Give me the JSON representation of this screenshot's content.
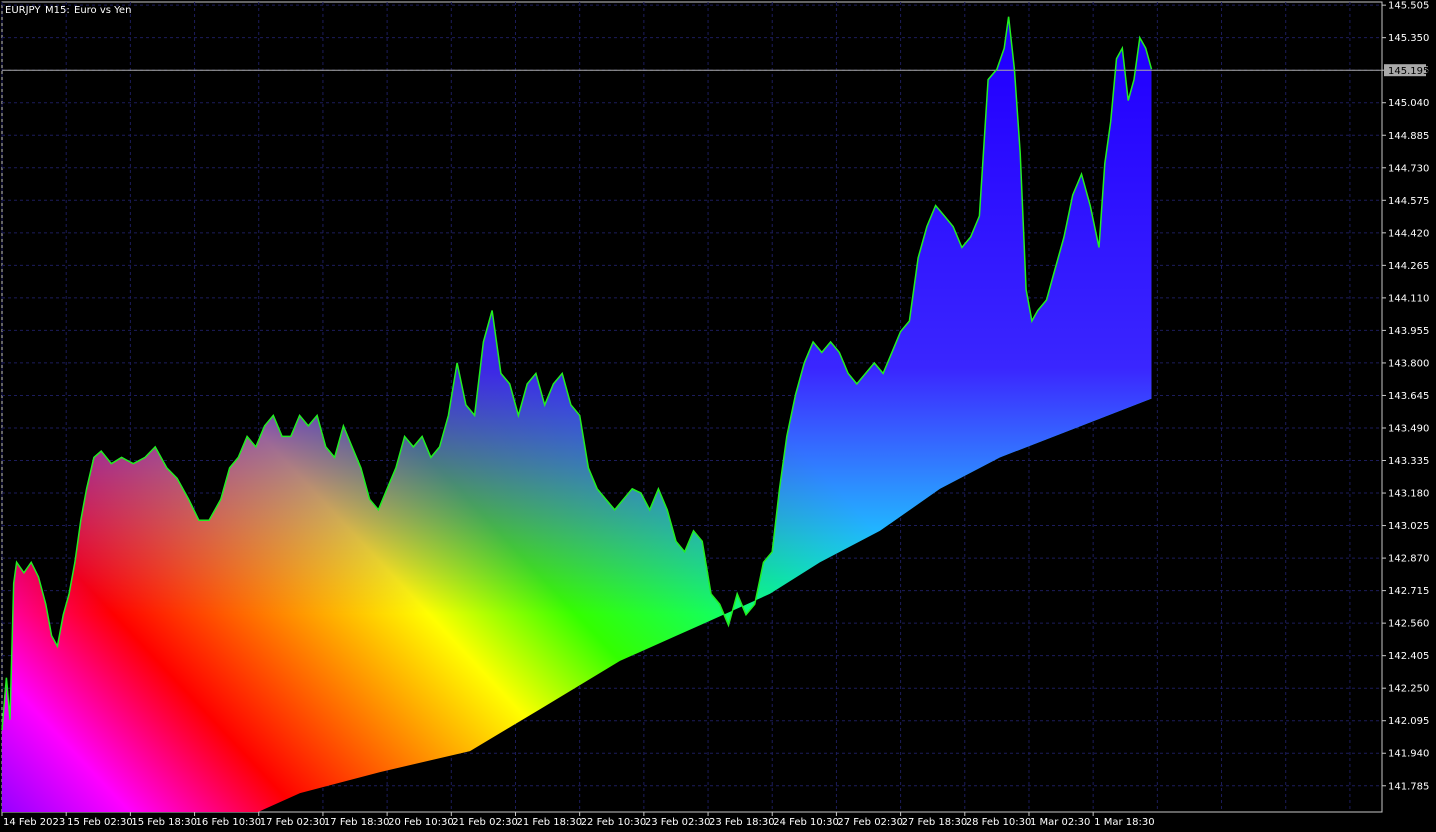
{
  "header": {
    "symbol": "EURJPY",
    "timeframe": "M15:",
    "description": "Euro vs Yen"
  },
  "colors": {
    "background": "#000000",
    "grid": "#1c1c5c",
    "axis": "#c8c8c8",
    "text": "#ffffff",
    "price_line": "#aaaaaa",
    "price_series": "#22ee22",
    "price_tag_bg": "#a9a9a9"
  },
  "chart_data": {
    "type": "area",
    "y_axis": {
      "side": "right",
      "ticks": [
        "145.505",
        "145.350",
        "145.195",
        "145.040",
        "144.885",
        "144.730",
        "144.575",
        "144.420",
        "144.265",
        "144.110",
        "143.955",
        "143.800",
        "143.645",
        "143.490",
        "143.335",
        "143.180",
        "143.025",
        "142.870",
        "142.715",
        "142.560",
        "142.405",
        "142.250",
        "142.095",
        "141.940",
        "141.785"
      ],
      "ylim": [
        141.66,
        145.52
      ]
    },
    "x_axis": {
      "ticks": [
        "14 Feb 2023",
        "15 Feb 02:30",
        "15 Feb 18:30",
        "16 Feb 10:30",
        "17 Feb 02:30",
        "17 Feb 18:30",
        "20 Feb 10:30",
        "21 Feb 02:30",
        "21 Feb 18:30",
        "22 Feb 10:30",
        "23 Feb 02:30",
        "23 Feb 18:30",
        "24 Feb 10:30",
        "27 Feb 02:30",
        "27 Feb 18:30",
        "28 Feb 10:30",
        "1 Mar 02:30",
        "1 Mar 18:30"
      ]
    },
    "current_price": "145.195",
    "grid": true,
    "series": [
      {
        "role": "price",
        "color": "#22ee22",
        "points": [
          [
            0.0,
            142.05
          ],
          [
            0.3,
            142.3
          ],
          [
            0.55,
            142.1
          ],
          [
            0.8,
            142.75
          ],
          [
            1.0,
            142.85
          ],
          [
            1.5,
            142.8
          ],
          [
            2.0,
            142.85
          ],
          [
            2.5,
            142.78
          ],
          [
            3.0,
            142.65
          ],
          [
            3.4,
            142.5
          ],
          [
            3.8,
            142.45
          ],
          [
            4.2,
            142.6
          ],
          [
            4.6,
            142.7
          ],
          [
            5.0,
            142.85
          ],
          [
            5.4,
            143.05
          ],
          [
            5.8,
            143.2
          ],
          [
            6.3,
            143.35
          ],
          [
            6.8,
            143.38
          ],
          [
            7.5,
            143.32
          ],
          [
            8.2,
            143.35
          ],
          [
            9.0,
            143.32
          ],
          [
            9.8,
            143.35
          ],
          [
            10.5,
            143.4
          ],
          [
            11.3,
            143.3
          ],
          [
            12.0,
            143.25
          ],
          [
            12.8,
            143.15
          ],
          [
            13.5,
            143.05
          ],
          [
            14.2,
            143.05
          ],
          [
            15.0,
            143.15
          ],
          [
            15.6,
            143.3
          ],
          [
            16.2,
            143.35
          ],
          [
            16.8,
            143.45
          ],
          [
            17.4,
            143.4
          ],
          [
            18.0,
            143.5
          ],
          [
            18.6,
            143.55
          ],
          [
            19.2,
            143.45
          ],
          [
            19.8,
            143.45
          ],
          [
            20.4,
            143.55
          ],
          [
            21.0,
            143.5
          ],
          [
            21.6,
            143.55
          ],
          [
            22.2,
            143.4
          ],
          [
            22.8,
            143.35
          ],
          [
            23.4,
            143.5
          ],
          [
            24.0,
            143.4
          ],
          [
            24.6,
            143.3
          ],
          [
            25.2,
            143.15
          ],
          [
            25.8,
            143.1
          ],
          [
            26.4,
            143.2
          ],
          [
            27.0,
            143.3
          ],
          [
            27.6,
            143.45
          ],
          [
            28.2,
            143.4
          ],
          [
            28.8,
            143.45
          ],
          [
            29.4,
            143.35
          ],
          [
            30.0,
            143.4
          ],
          [
            30.6,
            143.55
          ],
          [
            31.2,
            143.8
          ],
          [
            31.8,
            143.6
          ],
          [
            32.4,
            143.55
          ],
          [
            33.0,
            143.9
          ],
          [
            33.6,
            144.05
          ],
          [
            34.2,
            143.75
          ],
          [
            34.8,
            143.7
          ],
          [
            35.4,
            143.55
          ],
          [
            36.0,
            143.7
          ],
          [
            36.6,
            143.75
          ],
          [
            37.2,
            143.6
          ],
          [
            37.8,
            143.7
          ],
          [
            38.4,
            143.75
          ],
          [
            39.0,
            143.6
          ],
          [
            39.6,
            143.55
          ],
          [
            40.2,
            143.3
          ],
          [
            40.8,
            143.2
          ],
          [
            41.4,
            143.15
          ],
          [
            42.0,
            143.1
          ],
          [
            42.6,
            143.15
          ],
          [
            43.2,
            143.2
          ],
          [
            43.8,
            143.18
          ],
          [
            44.4,
            143.1
          ],
          [
            45.0,
            143.2
          ],
          [
            45.6,
            143.1
          ],
          [
            46.2,
            142.95
          ],
          [
            46.8,
            142.9
          ],
          [
            47.4,
            143.0
          ],
          [
            48.0,
            142.95
          ],
          [
            48.6,
            142.7
          ],
          [
            49.2,
            142.65
          ],
          [
            49.8,
            142.55
          ],
          [
            50.4,
            142.7
          ],
          [
            51.0,
            142.6
          ],
          [
            51.6,
            142.65
          ],
          [
            52.2,
            142.85
          ],
          [
            52.8,
            142.9
          ],
          [
            53.3,
            143.2
          ],
          [
            53.8,
            143.45
          ],
          [
            54.4,
            143.65
          ],
          [
            55.0,
            143.8
          ],
          [
            55.6,
            143.9
          ],
          [
            56.2,
            143.85
          ],
          [
            56.8,
            143.9
          ],
          [
            57.4,
            143.85
          ],
          [
            58.0,
            143.75
          ],
          [
            58.6,
            143.7
          ],
          [
            59.2,
            143.75
          ],
          [
            59.8,
            143.8
          ],
          [
            60.4,
            143.75
          ],
          [
            61.0,
            143.85
          ],
          [
            61.6,
            143.95
          ],
          [
            62.2,
            144.0
          ],
          [
            62.8,
            144.3
          ],
          [
            63.4,
            144.45
          ],
          [
            64.0,
            144.55
          ],
          [
            64.6,
            144.5
          ],
          [
            65.2,
            144.45
          ],
          [
            65.8,
            144.35
          ],
          [
            66.4,
            144.4
          ],
          [
            67.0,
            144.5
          ],
          [
            67.6,
            145.15
          ],
          [
            68.2,
            145.2
          ],
          [
            68.7,
            145.3
          ],
          [
            69.0,
            145.45
          ],
          [
            69.4,
            145.2
          ],
          [
            69.8,
            144.8
          ],
          [
            70.2,
            144.15
          ],
          [
            70.6,
            144.0
          ],
          [
            71.0,
            144.05
          ],
          [
            71.6,
            144.1
          ],
          [
            72.2,
            144.25
          ],
          [
            72.8,
            144.4
          ],
          [
            73.4,
            144.6
          ],
          [
            74.0,
            144.7
          ],
          [
            74.6,
            144.55
          ],
          [
            75.2,
            144.35
          ],
          [
            75.6,
            144.75
          ],
          [
            76.0,
            144.95
          ],
          [
            76.4,
            145.25
          ],
          [
            76.8,
            145.3
          ],
          [
            77.2,
            145.05
          ],
          [
            77.6,
            145.15
          ],
          [
            78.0,
            145.35
          ],
          [
            78.4,
            145.3
          ],
          [
            78.8,
            145.2
          ]
        ]
      }
    ]
  }
}
